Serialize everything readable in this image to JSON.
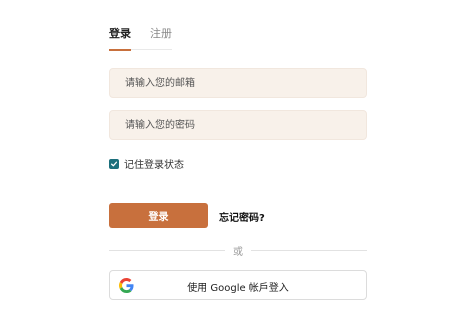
{
  "tabs": [
    {
      "label": "登录",
      "active": true
    },
    {
      "label": "注册",
      "active": false
    }
  ],
  "form": {
    "email_placeholder": "请输入您的邮箱",
    "email_value": "",
    "password_placeholder": "请输入您的密码",
    "password_value": "",
    "remember_label": "记住登录状态",
    "remember_checked": true,
    "login_label": "登录",
    "forgot_label": "忘记密码?"
  },
  "divider_text": "或",
  "google": {
    "label": "使用 Google 帐戶登入",
    "icon": "google-icon"
  },
  "colors": {
    "accent": "#c8703d",
    "input_bg": "#f8f1ea",
    "checkbox": "#1b6f7c"
  }
}
